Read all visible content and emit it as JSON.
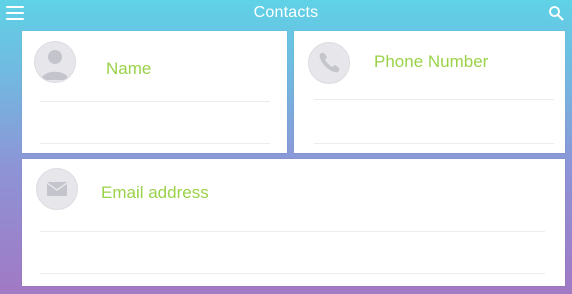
{
  "header": {
    "title": "Contacts",
    "menu_icon": "hamburger-menu-icon",
    "search_icon": "search-icon"
  },
  "cards": {
    "name": {
      "label": "Name",
      "icon": "person-icon"
    },
    "phone": {
      "label": "Phone Number",
      "icon": "phone-icon"
    },
    "email": {
      "label": "Email address",
      "icon": "envelope-icon"
    }
  },
  "colors": {
    "gradient_top": "#5fd2e6",
    "gradient_bottom": "#a179c4",
    "label_green": "#9ad24a",
    "card_background": "#ffffff",
    "icon_gray": "#c4c4cc"
  }
}
